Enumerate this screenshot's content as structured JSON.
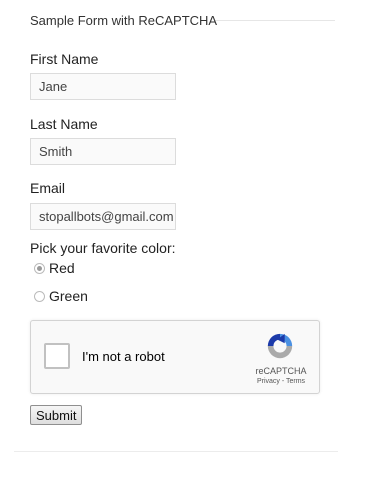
{
  "form": {
    "legend": "Sample Form with ReCAPTCHA",
    "first_name": {
      "label": "First Name",
      "value": "Jane"
    },
    "last_name": {
      "label": "Last Name",
      "value": "Smith"
    },
    "email": {
      "label": "Email",
      "value": "stopallbots@gmail.com"
    },
    "color": {
      "label": "Pick your favorite color:",
      "options": [
        {
          "label": "Red",
          "checked": true
        },
        {
          "label": "Green",
          "checked": false
        }
      ]
    },
    "recaptcha": {
      "checkbox_label": "I'm not a robot",
      "brand": "reCAPTCHA",
      "links": "Privacy - Terms"
    },
    "submit_label": "Submit"
  },
  "colors": {
    "recaptcha_blue": "#1c3aa9",
    "recaptcha_light_blue": "#4a90e2",
    "recaptcha_gray": "#aaaaaa"
  }
}
